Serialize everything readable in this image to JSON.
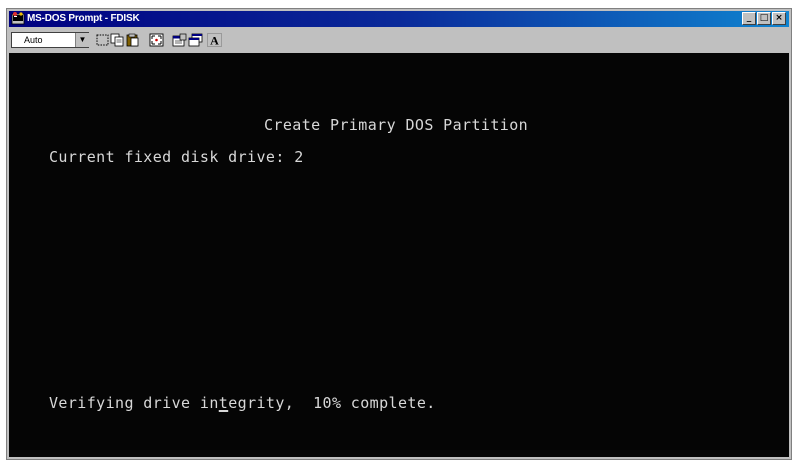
{
  "window": {
    "title": "MS-DOS Prompt - FDISK",
    "buttons": {
      "minimize": "_",
      "maximize": "□",
      "close": "×"
    }
  },
  "toolbar": {
    "font_size_value": "Auto",
    "tools": [
      "mark-icon",
      "copy-icon",
      "paste-icon",
      "full-screen-icon",
      "properties-icon",
      "background-icon",
      "font-icon"
    ]
  },
  "console": {
    "heading": "Create Primary DOS Partition",
    "drive_line": "Current fixed disk drive: 2",
    "status_prefix": "Verifying drive in",
    "status_cursor_char": "t",
    "status_suffix": "egrity,  10% complete.",
    "progress_percent": 10
  }
}
